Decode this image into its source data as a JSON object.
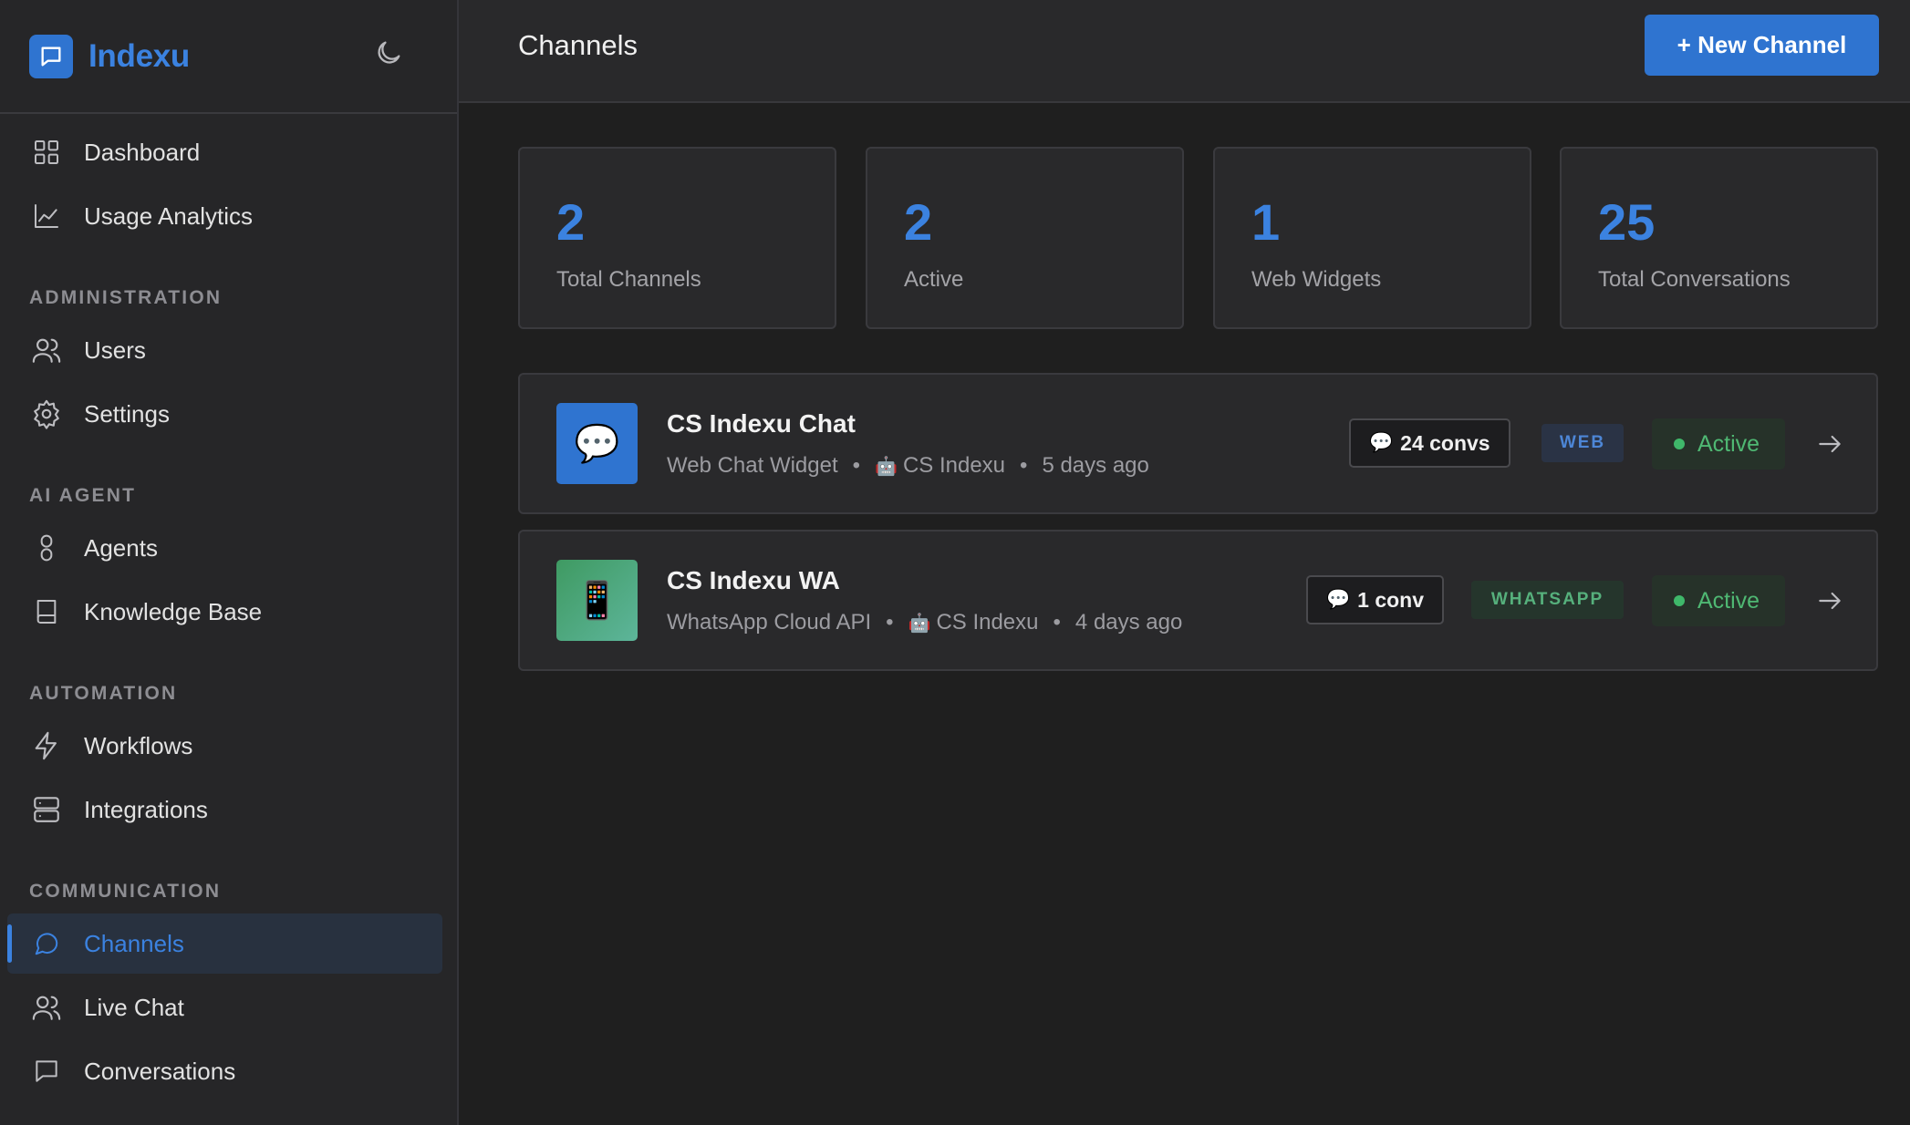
{
  "app": {
    "name": "Indexu"
  },
  "sidebar": {
    "items": [
      {
        "label": "Dashboard"
      },
      {
        "label": "Usage Analytics"
      },
      {
        "label": "Users"
      },
      {
        "label": "Settings"
      },
      {
        "label": "Agents"
      },
      {
        "label": "Knowledge Base"
      },
      {
        "label": "Workflows"
      },
      {
        "label": "Integrations"
      },
      {
        "label": "Channels",
        "active": true
      },
      {
        "label": "Live Chat"
      },
      {
        "label": "Conversations"
      }
    ],
    "sections": [
      "ADMINISTRATION",
      "AI AGENT",
      "AUTOMATION",
      "COMMUNICATION"
    ]
  },
  "header": {
    "title": "Channels",
    "new_button": "+ New Channel"
  },
  "stats": [
    {
      "value": "2",
      "label": "Total Channels"
    },
    {
      "value": "2",
      "label": "Active"
    },
    {
      "value": "1",
      "label": "Web Widgets"
    },
    {
      "value": "25",
      "label": "Total Conversations"
    }
  ],
  "channels": [
    {
      "icon": "💬",
      "name": "CS Indexu Chat",
      "type": "Web Chat Widget",
      "agent": "CS Indexu",
      "agent_icon": "🤖",
      "updated": "5 days ago",
      "conv_icon": "💬",
      "convs": "24 convs",
      "badge": "WEB",
      "status": "Active"
    },
    {
      "icon": "📱",
      "name": "CS Indexu WA",
      "type": "WhatsApp Cloud API",
      "agent": "CS Indexu",
      "agent_icon": "🤖",
      "updated": "4 days ago",
      "conv_icon": "💬",
      "convs": "1 conv",
      "badge": "WHATSAPP",
      "status": "Active"
    }
  ],
  "colors": {
    "accent": "#3b82e0",
    "web_icon_bg": "#2f74d0",
    "wa_icon_bg": "#49a877",
    "active_green": "#4fb873"
  }
}
